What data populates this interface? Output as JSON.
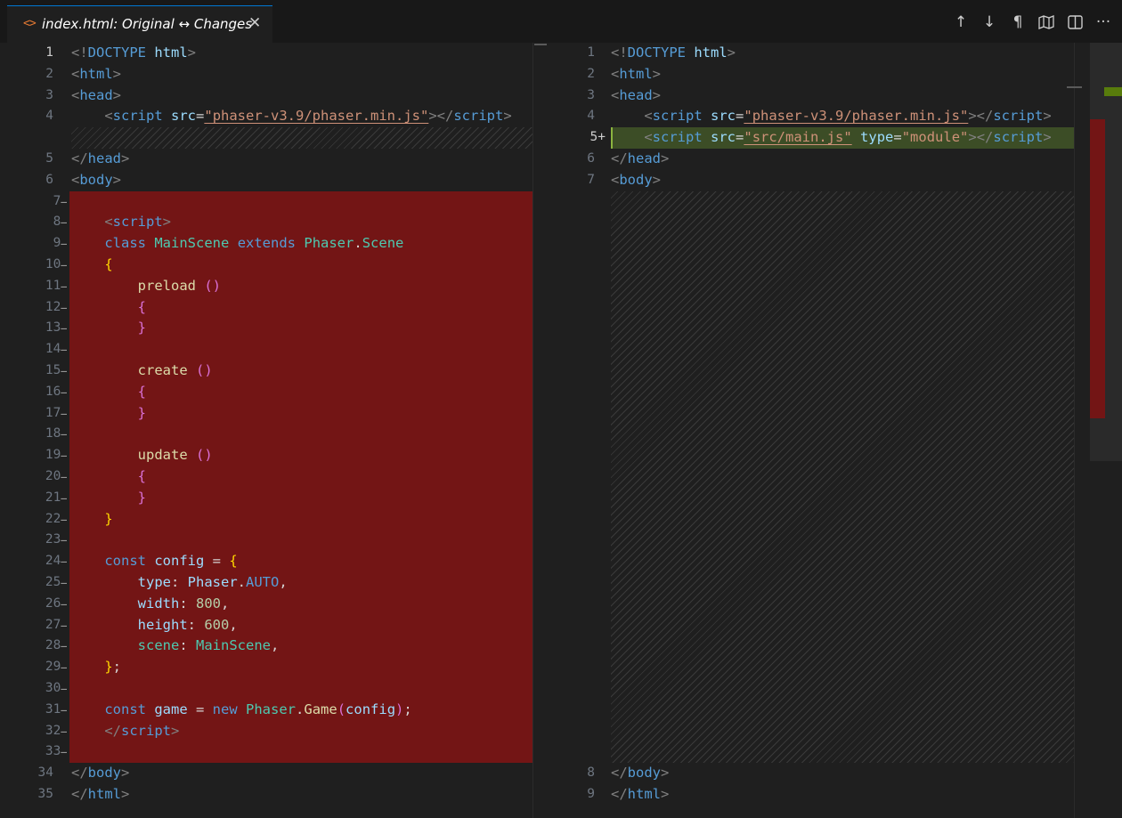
{
  "tab": {
    "icon": "<>",
    "title": "index.html: Original ↔ Changes",
    "close": "✕"
  },
  "toolbar": {
    "prev_change": "↑",
    "next_change": "↓",
    "whitespace": "¶",
    "more": "···",
    "icons": [
      "arrow-up-icon",
      "arrow-down-icon",
      "pilcrow-icon",
      "map-icon",
      "split-editor-icon",
      "more-icon"
    ]
  },
  "colors": {
    "removed": "#731515",
    "inserted": "#3c4d26",
    "accent": "#0078d4"
  },
  "original": {
    "line_numbers": [
      "1",
      "2",
      "3",
      "4",
      "",
      "5",
      "6",
      "7",
      "8",
      "9",
      "10",
      "11",
      "12",
      "13",
      "14",
      "15",
      "16",
      "17",
      "18",
      "19",
      "20",
      "21",
      "22",
      "23",
      "24",
      "25",
      "26",
      "27",
      "28",
      "29",
      "30",
      "31",
      "32",
      "33",
      "34",
      "35"
    ],
    "removed_lines": [
      7,
      33
    ],
    "lines": [
      [
        [
          "p",
          "<!"
        ],
        [
          "t",
          "DOCTYPE"
        ],
        [
          "w",
          " "
        ],
        [
          "a",
          "html"
        ],
        [
          "p",
          ">"
        ]
      ],
      [
        [
          "p",
          "<"
        ],
        [
          "t",
          "html"
        ],
        [
          "p",
          ">"
        ]
      ],
      [
        [
          "p",
          "<"
        ],
        [
          "t",
          "head"
        ],
        [
          "p",
          ">"
        ]
      ],
      [
        [
          "w",
          "    "
        ],
        [
          "p",
          "<"
        ],
        [
          "t",
          "script"
        ],
        [
          "w",
          " "
        ],
        [
          "a",
          "src"
        ],
        [
          "w",
          "="
        ],
        [
          "s",
          "\"phaser-v3.9/phaser.min.js\""
        ],
        [
          "p",
          "></"
        ],
        [
          "t",
          "script"
        ],
        [
          "p",
          ">"
        ]
      ],
      [],
      [
        [
          "p",
          "</"
        ],
        [
          "t",
          "head"
        ],
        [
          "p",
          ">"
        ]
      ],
      [
        [
          "p",
          "<"
        ],
        [
          "t",
          "body"
        ],
        [
          "p",
          ">"
        ]
      ],
      [],
      [
        [
          "w",
          "    "
        ],
        [
          "p",
          "<"
        ],
        [
          "t",
          "script"
        ],
        [
          "p",
          ">"
        ]
      ],
      [
        [
          "w",
          "    "
        ],
        [
          "k",
          "class"
        ],
        [
          "w",
          " "
        ],
        [
          "cl",
          "MainScene"
        ],
        [
          "w",
          " "
        ],
        [
          "k",
          "extends"
        ],
        [
          "w",
          " "
        ],
        [
          "cl",
          "Phaser"
        ],
        [
          "w",
          "."
        ],
        [
          "cl",
          "Scene"
        ]
      ],
      [
        [
          "w",
          "    "
        ],
        [
          "y",
          "{"
        ]
      ],
      [
        [
          "w",
          "        "
        ],
        [
          "fn",
          "preload"
        ],
        [
          "w",
          " "
        ],
        [
          "pk",
          "()"
        ]
      ],
      [
        [
          "w",
          "        "
        ],
        [
          "pk",
          "{"
        ]
      ],
      [
        [
          "w",
          "        "
        ],
        [
          "pk",
          "}"
        ]
      ],
      [],
      [
        [
          "w",
          "        "
        ],
        [
          "fn",
          "create"
        ],
        [
          "w",
          " "
        ],
        [
          "pk",
          "()"
        ]
      ],
      [
        [
          "w",
          "        "
        ],
        [
          "pk",
          "{"
        ]
      ],
      [
        [
          "w",
          "        "
        ],
        [
          "pk",
          "}"
        ]
      ],
      [],
      [
        [
          "w",
          "        "
        ],
        [
          "fn",
          "update"
        ],
        [
          "w",
          " "
        ],
        [
          "pk",
          "()"
        ]
      ],
      [
        [
          "w",
          "        "
        ],
        [
          "pk",
          "{"
        ]
      ],
      [
        [
          "w",
          "        "
        ],
        [
          "pk",
          "}"
        ]
      ],
      [
        [
          "w",
          "    "
        ],
        [
          "y",
          "}"
        ]
      ],
      [],
      [
        [
          "w",
          "    "
        ],
        [
          "k",
          "const"
        ],
        [
          "w",
          " "
        ],
        [
          "v",
          "config"
        ],
        [
          "w",
          " = "
        ],
        [
          "y",
          "{"
        ]
      ],
      [
        [
          "w",
          "        "
        ],
        [
          "v",
          "type"
        ],
        [
          "w",
          ": "
        ],
        [
          "v",
          "Phaser"
        ],
        [
          "w",
          "."
        ],
        [
          "t",
          "AUTO"
        ],
        [
          "w",
          ","
        ]
      ],
      [
        [
          "w",
          "        "
        ],
        [
          "v",
          "width"
        ],
        [
          "w",
          ": "
        ],
        [
          "n",
          "800"
        ],
        [
          "w",
          ","
        ]
      ],
      [
        [
          "w",
          "        "
        ],
        [
          "v",
          "height"
        ],
        [
          "w",
          ": "
        ],
        [
          "n",
          "600"
        ],
        [
          "w",
          ","
        ]
      ],
      [
        [
          "w",
          "        "
        ],
        [
          "cl",
          "scene"
        ],
        [
          "w",
          ": "
        ],
        [
          "cl",
          "MainScene"
        ],
        [
          "w",
          ","
        ]
      ],
      [
        [
          "w",
          "    "
        ],
        [
          "y",
          "}"
        ],
        [
          "w",
          ";"
        ]
      ],
      [],
      [
        [
          "w",
          "    "
        ],
        [
          "k",
          "const"
        ],
        [
          "w",
          " "
        ],
        [
          "v",
          "game"
        ],
        [
          "w",
          " = "
        ],
        [
          "k",
          "new"
        ],
        [
          "w",
          " "
        ],
        [
          "cl",
          "Phaser"
        ],
        [
          "w",
          "."
        ],
        [
          "fn",
          "Game"
        ],
        [
          "pk",
          "("
        ],
        [
          "v",
          "config"
        ],
        [
          "pk",
          ")"
        ],
        [
          "w",
          ";"
        ]
      ],
      [
        [
          "w",
          "    "
        ],
        [
          "p",
          "</"
        ],
        [
          "t",
          "script"
        ],
        [
          "p",
          ">"
        ]
      ],
      [],
      [
        [
          "p",
          "</"
        ],
        [
          "t",
          "body"
        ],
        [
          "p",
          ">"
        ]
      ],
      [
        [
          "p",
          "</"
        ],
        [
          "t",
          "html"
        ],
        [
          "p",
          ">"
        ]
      ]
    ]
  },
  "modified": {
    "line_numbers": [
      "1",
      "2",
      "3",
      "4",
      "5",
      "6",
      "7",
      "8",
      "9"
    ],
    "inserted_line": 5,
    "lines": [
      [
        [
          "p",
          "<!"
        ],
        [
          "t",
          "DOCTYPE"
        ],
        [
          "w",
          " "
        ],
        [
          "a",
          "html"
        ],
        [
          "p",
          ">"
        ]
      ],
      [
        [
          "p",
          "<"
        ],
        [
          "t",
          "html"
        ],
        [
          "p",
          ">"
        ]
      ],
      [
        [
          "p",
          "<"
        ],
        [
          "t",
          "head"
        ],
        [
          "p",
          ">"
        ]
      ],
      [
        [
          "w",
          "    "
        ],
        [
          "p",
          "<"
        ],
        [
          "t",
          "script"
        ],
        [
          "w",
          " "
        ],
        [
          "a",
          "src"
        ],
        [
          "w",
          "="
        ],
        [
          "s",
          "\"phaser-v3.9/phaser.min.js\""
        ],
        [
          "p",
          "></"
        ],
        [
          "t",
          "script"
        ],
        [
          "p",
          ">"
        ]
      ],
      [
        [
          "w",
          "    "
        ],
        [
          "p",
          "<"
        ],
        [
          "t",
          "script"
        ],
        [
          "w",
          " "
        ],
        [
          "a",
          "src"
        ],
        [
          "w",
          "="
        ],
        [
          "s",
          "\"src/main.js\""
        ],
        [
          "w",
          " "
        ],
        [
          "a",
          "type"
        ],
        [
          "w",
          "="
        ],
        [
          "sv",
          "\"module\""
        ],
        [
          "p",
          "></"
        ],
        [
          "t",
          "script"
        ],
        [
          "p",
          ">"
        ]
      ],
      [
        [
          "p",
          "</"
        ],
        [
          "t",
          "head"
        ],
        [
          "p",
          ">"
        ]
      ],
      [
        [
          "p",
          "<"
        ],
        [
          "t",
          "body"
        ],
        [
          "p",
          ">"
        ]
      ],
      [
        [
          "p",
          "</"
        ],
        [
          "t",
          "body"
        ],
        [
          "p",
          ">"
        ]
      ],
      [
        [
          "p",
          "</"
        ],
        [
          "t",
          "html"
        ],
        [
          "p",
          ">"
        ]
      ]
    ]
  }
}
